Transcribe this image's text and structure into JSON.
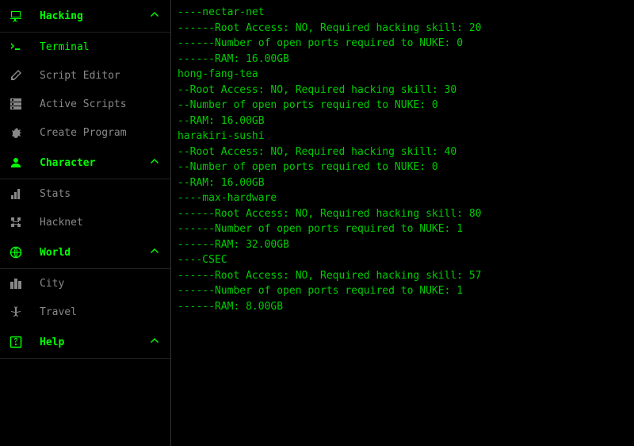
{
  "sidebar": {
    "sections": [
      {
        "id": "hacking",
        "label": "Hacking",
        "icon": "computer-icon",
        "items": [
          {
            "id": "terminal",
            "label": "Terminal",
            "icon": "terminal-icon",
            "active": true
          },
          {
            "id": "script-editor",
            "label": "Script Editor",
            "icon": "edit-icon",
            "active": false
          },
          {
            "id": "active-scripts",
            "label": "Active Scripts",
            "icon": "storage-icon",
            "active": false
          },
          {
            "id": "create-program",
            "label": "Create Program",
            "icon": "bug-icon",
            "active": false
          }
        ]
      },
      {
        "id": "character",
        "label": "Character",
        "icon": "person-icon",
        "items": [
          {
            "id": "stats",
            "label": "Stats",
            "icon": "bar-chart-icon",
            "active": false
          },
          {
            "id": "hacknet",
            "label": "Hacknet",
            "icon": "network-icon",
            "active": false
          }
        ]
      },
      {
        "id": "world",
        "label": "World",
        "icon": "globe-icon",
        "items": [
          {
            "id": "city",
            "label": "City",
            "icon": "city-icon",
            "active": false
          },
          {
            "id": "travel",
            "label": "Travel",
            "icon": "airplane-icon",
            "active": false
          }
        ]
      },
      {
        "id": "help",
        "label": "Help",
        "icon": "help-icon",
        "items": []
      }
    ]
  },
  "terminal": {
    "lines": [
      "----nectar-net",
      "------Root Access: NO, Required hacking skill: 20",
      "------Number of open ports required to NUKE: 0",
      "------RAM: 16.00GB",
      "",
      "hong-fang-tea",
      "--Root Access: NO, Required hacking skill: 30",
      "--Number of open ports required to NUKE: 0",
      "--RAM: 16.00GB",
      "",
      "harakiri-sushi",
      "--Root Access: NO, Required hacking skill: 40",
      "--Number of open ports required to NUKE: 0",
      "--RAM: 16.00GB",
      "",
      "----max-hardware",
      "------Root Access: NO, Required hacking skill: 80",
      "------Number of open ports required to NUKE: 1",
      "------RAM: 32.00GB",
      "",
      "----CSEC",
      "------Root Access: NO, Required hacking skill: 57",
      "------Number of open ports required to NUKE: 1",
      "------RAM: 8.00GB"
    ]
  },
  "colors": {
    "primary": "#00ff00",
    "secondary": "#888888",
    "text": "#00cc00",
    "background": "#000000"
  }
}
